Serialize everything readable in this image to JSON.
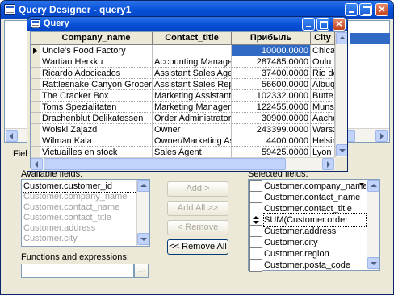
{
  "main_window": {
    "title": "Query Designer - query1",
    "left_tab_label": "Field",
    "available_fields_label": "Available fields:",
    "available_fields": [
      "Customer.customer_id",
      "Customer.company_name",
      "Customer.contact_name",
      "Customer.contact_title",
      "Customer.address",
      "Customer.city"
    ],
    "functions_label": "Functions and expressions:",
    "functions_value": "",
    "browse_label": "...",
    "buttons": {
      "add": "Add >",
      "add_all": "Add All >>",
      "remove": "< Remove",
      "remove_all": "<< Remove All"
    },
    "selected_fields_label": "Selected fields:",
    "selected_fields": [
      {
        "name": "Customer.company_name",
        "control": "dropdown"
      },
      {
        "name": "Customer.contact_name",
        "control": "none"
      },
      {
        "name": "Customer.contact_title",
        "control": "none"
      },
      {
        "name": "SUM(Customer.order",
        "control": "sort"
      },
      {
        "name": "Customer.address",
        "control": "none"
      },
      {
        "name": "Customer.city",
        "control": "none"
      },
      {
        "name": "Customer.region",
        "control": "none"
      },
      {
        "name": "Customer.posta_code",
        "control": "none"
      }
    ]
  },
  "query_window": {
    "title": "Query",
    "columns": [
      "Company_name",
      "Contact_title",
      "Прибыль",
      "City"
    ],
    "rows": [
      [
        "Uncle's Food Factory",
        "",
        "10000.0000",
        "Chica"
      ],
      [
        "Wartian Herkku",
        "Accounting Manager",
        "287485.0000",
        "Oulu"
      ],
      [
        "Ricardo Adocicados",
        "Assistant Sales Agent",
        "37400.0000",
        "Rio de"
      ],
      [
        "Rattlesnake Canyon Grocery",
        "Assistant Sales Repre",
        "56600.0000",
        "Albuq"
      ],
      [
        "The Cracker Box",
        "Marketing Assistant",
        "102332.0000",
        "Butte"
      ],
      [
        "Toms Spezialitaten",
        "Marketing Manager",
        "122455.0000",
        "Munst"
      ],
      [
        "Drachenblut Delikatessen",
        "Order Administrator",
        "30900.0000",
        "Aache"
      ],
      [
        "Wolski Zajazd",
        "Owner",
        "243399.0000",
        "Warsz"
      ],
      [
        "Wilman Kala",
        "Owner/Marketing Assi",
        "4400.0000",
        "Helsin"
      ],
      [
        "Victuailles en stock",
        "Sales Agent",
        "59425.0000",
        "Lyon"
      ]
    ]
  }
}
